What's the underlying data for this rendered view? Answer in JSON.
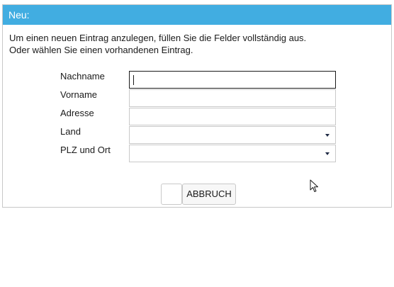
{
  "dialog": {
    "title": "Neu:",
    "intro_line1": "Um einen neuen Eintrag anzulegen, füllen Sie die Felder vollständig aus.",
    "intro_line2": "Oder wählen Sie einen vorhandenen Eintrag."
  },
  "form": {
    "nachname_label": "Nachname",
    "nachname_value": "",
    "vorname_label": "Vorname",
    "vorname_value": "",
    "adresse_label": "Adresse",
    "adresse_value": "",
    "land_label": "Land",
    "land_value": "",
    "plz_ort_label": "PLZ und Ort",
    "plz_ort_value": ""
  },
  "buttons": {
    "ok_label": "",
    "cancel_label": "ABBRUCH"
  },
  "colors": {
    "header_bg": "#41ade1",
    "header_text": "#ffffff"
  },
  "icons": {
    "dropdown": "chevron-down-icon",
    "cursor": "mouse-pointer-icon"
  }
}
